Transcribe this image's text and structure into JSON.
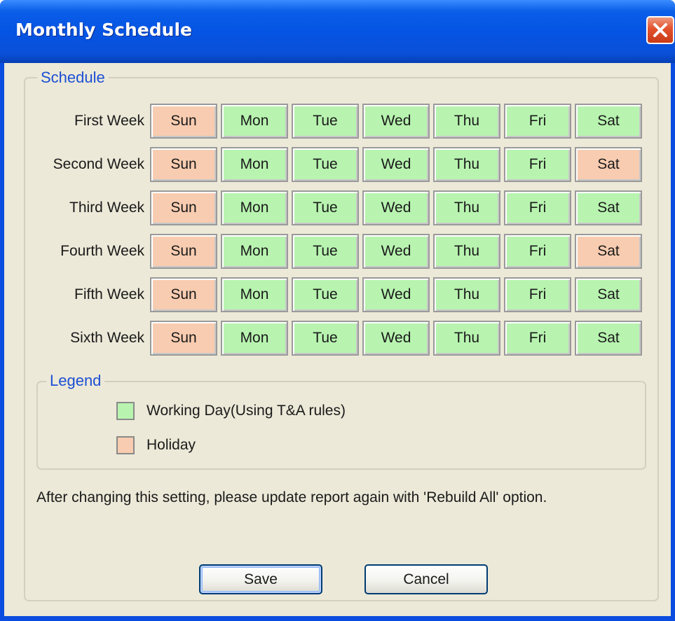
{
  "window": {
    "title": "Monthly Schedule"
  },
  "schedule": {
    "group_label": "Schedule",
    "weeks": [
      {
        "label": "First Week",
        "days": [
          "Sun",
          "Mon",
          "Tue",
          "Wed",
          "Thu",
          "Fri",
          "Sat"
        ],
        "states": [
          "holiday",
          "working",
          "working",
          "working",
          "working",
          "working",
          "working"
        ]
      },
      {
        "label": "Second Week",
        "days": [
          "Sun",
          "Mon",
          "Tue",
          "Wed",
          "Thu",
          "Fri",
          "Sat"
        ],
        "states": [
          "holiday",
          "working",
          "working",
          "working",
          "working",
          "working",
          "holiday"
        ]
      },
      {
        "label": "Third Week",
        "days": [
          "Sun",
          "Mon",
          "Tue",
          "Wed",
          "Thu",
          "Fri",
          "Sat"
        ],
        "states": [
          "holiday",
          "working",
          "working",
          "working",
          "working",
          "working",
          "working"
        ]
      },
      {
        "label": "Fourth Week",
        "days": [
          "Sun",
          "Mon",
          "Tue",
          "Wed",
          "Thu",
          "Fri",
          "Sat"
        ],
        "states": [
          "holiday",
          "working",
          "working",
          "working",
          "working",
          "working",
          "holiday"
        ]
      },
      {
        "label": "Fifth Week",
        "days": [
          "Sun",
          "Mon",
          "Tue",
          "Wed",
          "Thu",
          "Fri",
          "Sat"
        ],
        "states": [
          "holiday",
          "working",
          "working",
          "working",
          "working",
          "working",
          "working"
        ]
      },
      {
        "label": "Sixth Week",
        "days": [
          "Sun",
          "Mon",
          "Tue",
          "Wed",
          "Thu",
          "Fri",
          "Sat"
        ],
        "states": [
          "holiday",
          "working",
          "working",
          "working",
          "working",
          "working",
          "working"
        ]
      }
    ]
  },
  "legend": {
    "group_label": "Legend",
    "working_label": "Working Day(Using T&A rules)",
    "holiday_label": "Holiday"
  },
  "colors": {
    "working": "#b8f4b0",
    "holiday": "#f8ccb0",
    "title_bar": "#0554e3",
    "dialog_bg": "#ece9d8",
    "group_label": "#1c4fd4"
  },
  "note": {
    "text": "After changing this setting, please update report again with 'Rebuild All' option."
  },
  "buttons": {
    "save_label": "Save",
    "cancel_label": "Cancel"
  }
}
